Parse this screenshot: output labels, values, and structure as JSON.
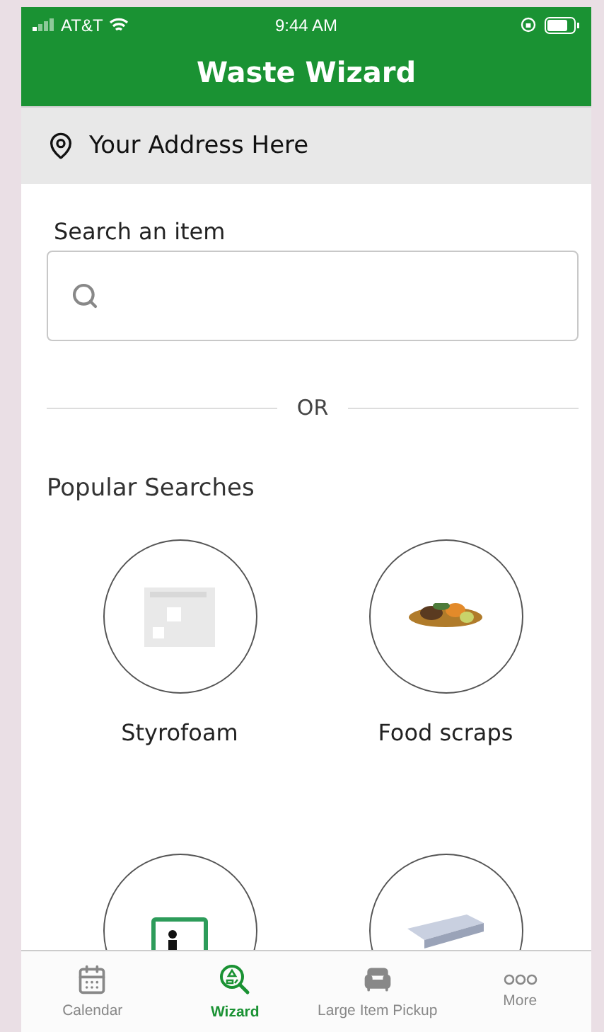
{
  "status_bar": {
    "carrier": "AT&T",
    "time": "9:44 AM"
  },
  "header": {
    "title": "Waste Wizard"
  },
  "address": {
    "text": "Your Address Here"
  },
  "search": {
    "label": "Search an item"
  },
  "divider": {
    "text": "OR"
  },
  "popular": {
    "title": "Popular Searches",
    "items": [
      {
        "label": "Styrofoam",
        "kind": "picture"
      },
      {
        "label": "Food scraps",
        "kind": "picture"
      },
      {
        "kind": "picture"
      },
      {
        "kind": "picture"
      }
    ]
  },
  "tabs": [
    {
      "label": "Calendar",
      "kind": "calendar",
      "selected": false
    },
    {
      "label": "Wizard",
      "kind": "wizard",
      "selected": true
    },
    {
      "label": "Large Item Pickup",
      "kind": "chair",
      "selected": false
    },
    {
      "label": "More",
      "kind": "more",
      "selected": false
    }
  ]
}
